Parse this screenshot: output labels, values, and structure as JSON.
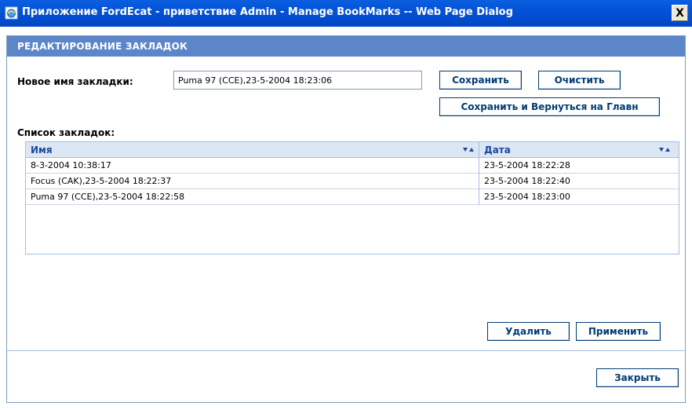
{
  "window": {
    "title": "Приложение FordEcat - приветствие Admin - Manage BookMarks -- Web Page Dialog",
    "close_label": "X"
  },
  "section": {
    "title": "РЕДАКТИРОВАНИЕ ЗАКЛАДОК"
  },
  "form": {
    "name_label": "Новое имя закладки:",
    "name_value": "Puma 97 (CCE),23-5-2004 18:23:06",
    "save_label": "Сохранить",
    "clear_label": "Очистить",
    "save_return_label": "Сохранить и Вернуться на Главн"
  },
  "list": {
    "label": "Список закладок:",
    "columns": [
      "Имя",
      "Дата"
    ],
    "rows": [
      {
        "name": "8-3-2004 10:38:17",
        "date": "23-5-2004 18:22:28"
      },
      {
        "name": "Focus (CAK),23-5-2004 18:22:37",
        "date": "23-5-2004 18:22:40"
      },
      {
        "name": "Puma 97 (CCE),23-5-2004 18:22:58",
        "date": "23-5-2004 18:23:00"
      }
    ],
    "delete_label": "Удалить",
    "apply_label": "Применить"
  },
  "footer": {
    "close_label": "Закрыть"
  },
  "icons": {
    "window": "ie-page-icon",
    "sort": "sort-arrows-icon"
  },
  "colors": {
    "titlebar": "#0352d6",
    "section_header": "#5b86c9",
    "grid_header": "#dce6f4",
    "button_text": "#003c74"
  }
}
